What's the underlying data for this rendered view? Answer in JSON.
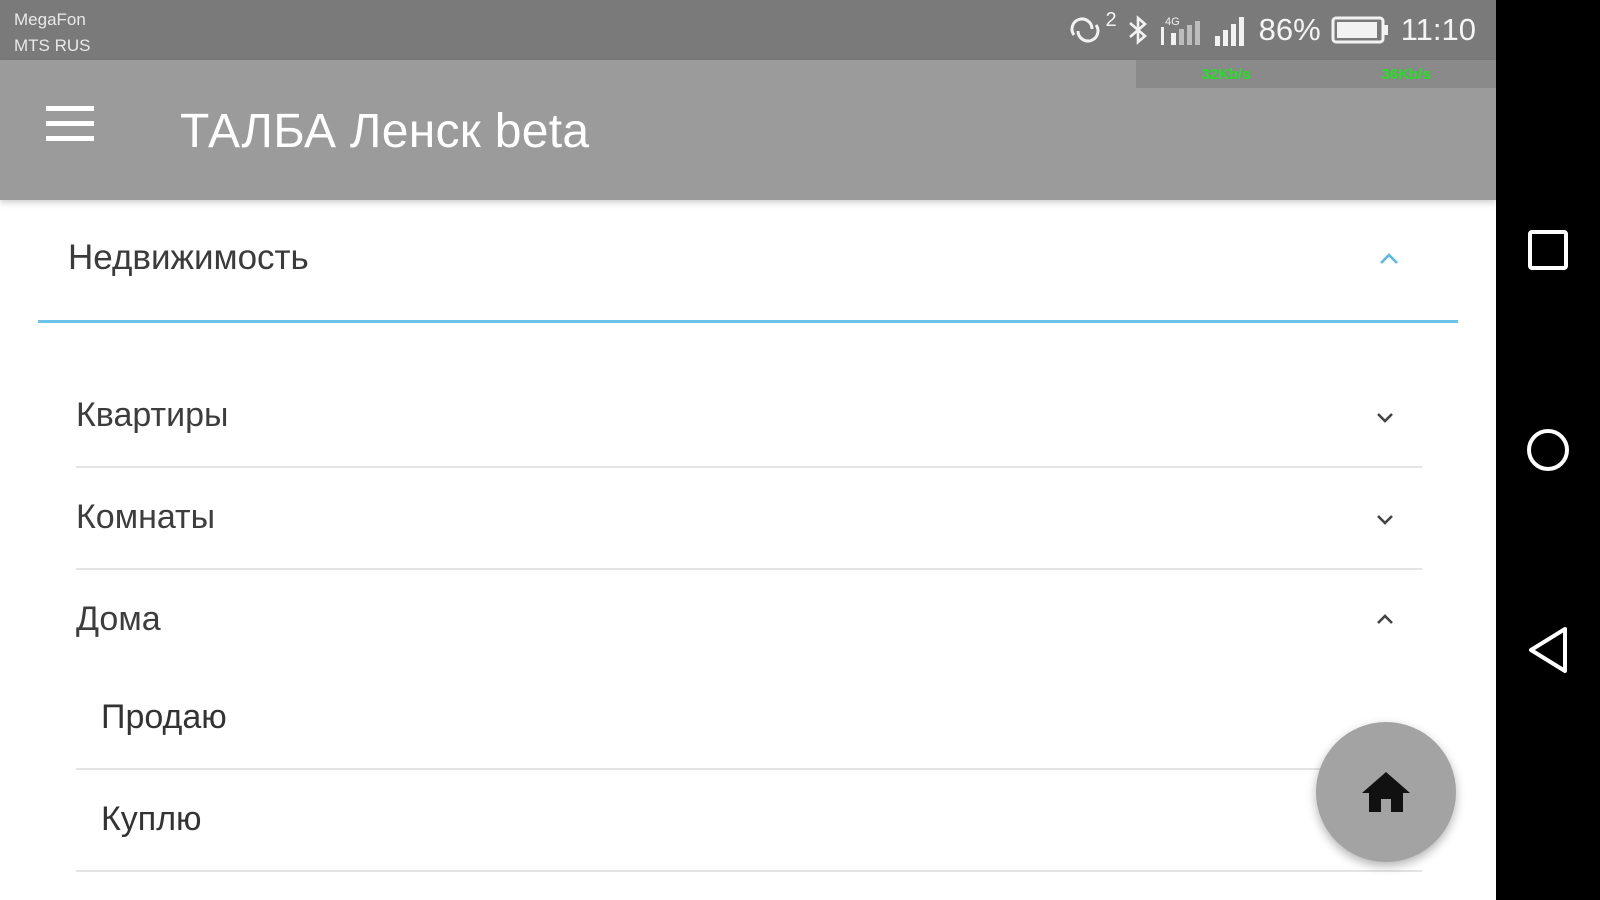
{
  "status_bar": {
    "carrier_1": "MegaFon",
    "carrier_2": "MTS RUS",
    "sync_count": "2",
    "network_label": "4G",
    "battery": "86%",
    "time": "11:10",
    "speed_up": "32Kb/s",
    "speed_down": "36Kb/s"
  },
  "app_bar": {
    "title": "ТАЛБА Ленск beta",
    "menu_icon": "hamburger-menu-icon"
  },
  "section": {
    "title": "Недвижимость",
    "expanded": true,
    "accent_color": "#6cc3ea"
  },
  "categories": [
    {
      "label": "Квартиры",
      "expanded": false
    },
    {
      "label": "Комнаты",
      "expanded": false
    },
    {
      "label": "Дома",
      "expanded": true
    }
  ],
  "subitems": [
    {
      "label": "Продаю"
    },
    {
      "label": "Куплю"
    }
  ],
  "fab": {
    "icon": "home-icon"
  },
  "nav_bar": {
    "recents": "square-recents-icon",
    "home": "circle-home-icon",
    "back": "triangle-back-icon"
  }
}
